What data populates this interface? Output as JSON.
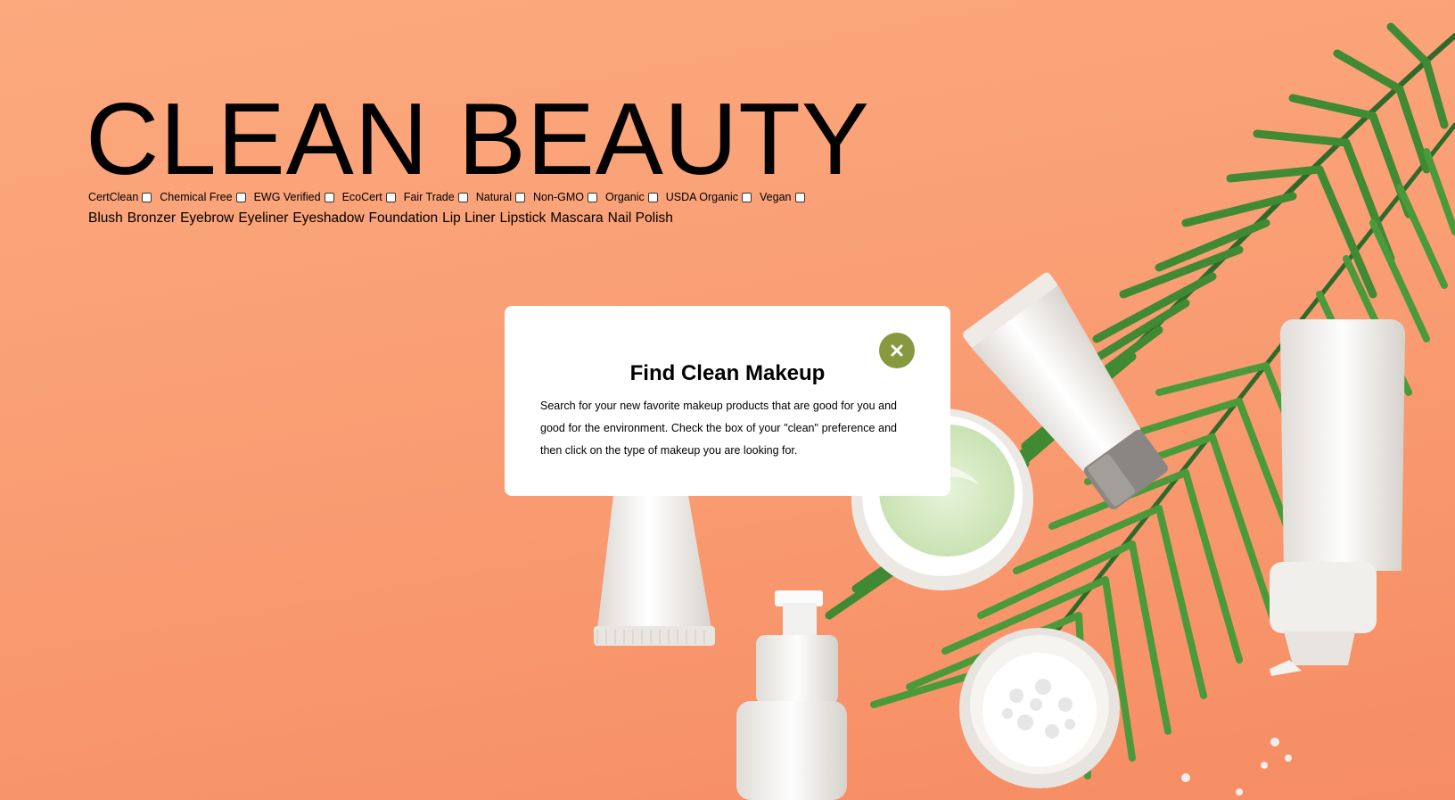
{
  "header": {
    "title": "CLEAN BEAUTY"
  },
  "filters": [
    {
      "label": "CertClean",
      "checked": false
    },
    {
      "label": "Chemical Free",
      "checked": false
    },
    {
      "label": "EWG Verified",
      "checked": false
    },
    {
      "label": "EcoCert",
      "checked": false
    },
    {
      "label": "Fair Trade",
      "checked": false
    },
    {
      "label": "Natural",
      "checked": false
    },
    {
      "label": "Non-GMO",
      "checked": false
    },
    {
      "label": "Organic",
      "checked": false
    },
    {
      "label": "USDA Organic",
      "checked": false
    },
    {
      "label": "Vegan",
      "checked": false
    }
  ],
  "categories": [
    "Blush",
    "Bronzer",
    "Eyebrow",
    "Eyeliner",
    "Eyeshadow",
    "Foundation",
    "Lip Liner",
    "Lipstick",
    "Mascara",
    "Nail Polish"
  ],
  "modal": {
    "title": "Find Clean Makeup",
    "body": "Search for your new favorite makeup products that are good for you and good for the environment. Check the box of your \"clean\" preference and then click on the type of makeup you are looking for.",
    "close_icon": "close-icon"
  },
  "colors": {
    "background": "#f9a079",
    "accent": "#86993f",
    "modal_bg": "#ffffff"
  }
}
